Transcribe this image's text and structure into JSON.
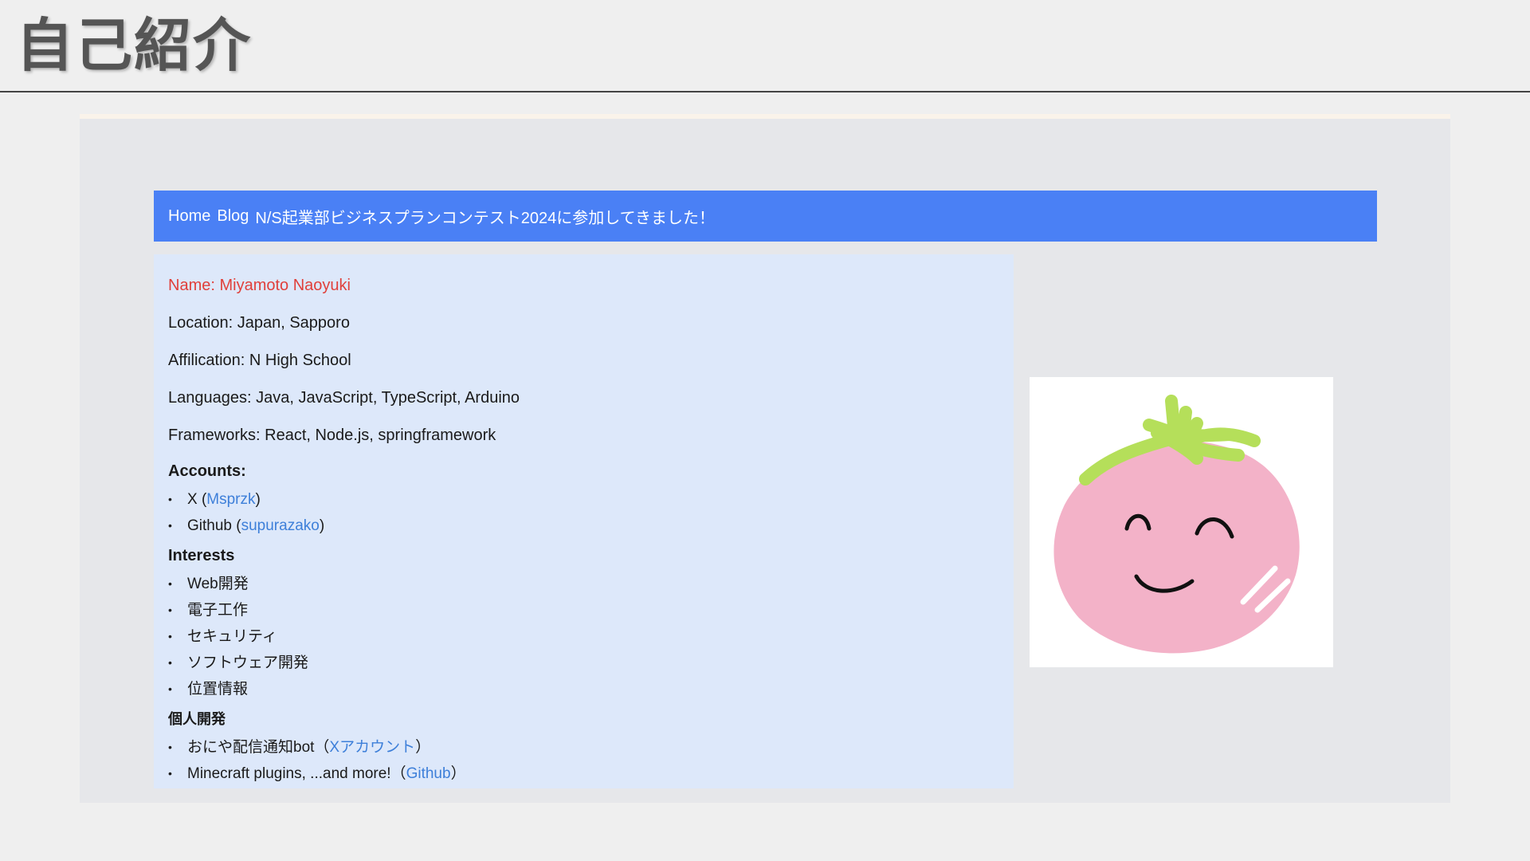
{
  "slide": {
    "title": "自己紹介"
  },
  "nav": {
    "home": "Home",
    "blog": "Blog",
    "post": "N/S起業部ビジネスプランコンテスト2024に参加してきました！"
  },
  "profile": {
    "name": "Name: Miyamoto Naoyuki",
    "location": "Location: Japan, Sapporo",
    "affiliation": "Affilication: N High School",
    "languages": "Languages: Java, JavaScript, TypeScript, Arduino",
    "frameworks": "Frameworks: React, Node.js, springframework"
  },
  "accounts": {
    "heading": "Accounts:",
    "x": {
      "label": "X (",
      "link": "Msprzk",
      "close": ")"
    },
    "github": {
      "label": "Github (",
      "link": "supurazako",
      "close": ")"
    }
  },
  "interests": {
    "heading": "Interests",
    "items": [
      "Web開発",
      "電子工作",
      "セキュリティ",
      "ソフトウェア開発",
      "位置情報"
    ]
  },
  "projects": {
    "heading": "個人開発",
    "onigiri": {
      "label": "おにや配信通知bot（",
      "link": "Xアカウント",
      "close": "）"
    },
    "minecraft": {
      "label": "Minecraft plugins, ...and more!（",
      "link": "Github",
      "close": "）"
    }
  },
  "avatar": {
    "icon": "tomato-face-icon"
  },
  "colors": {
    "nav": "#4a80f5",
    "card": "#dde8fa",
    "name": "#e0403a",
    "link": "#3d7fd9"
  }
}
